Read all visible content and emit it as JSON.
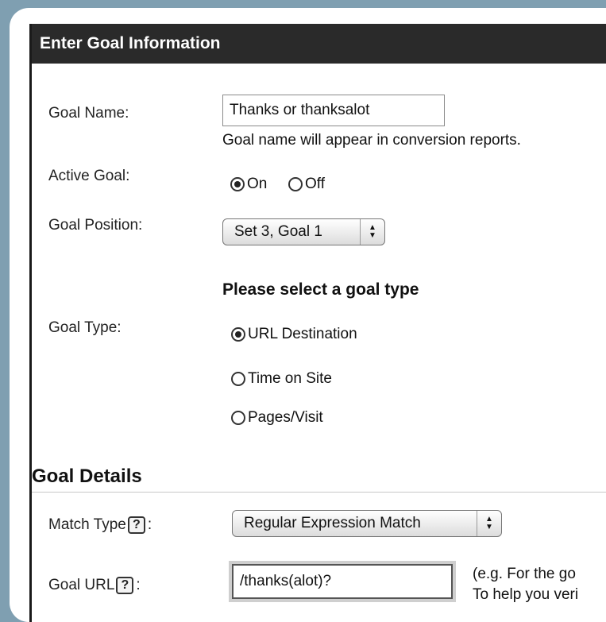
{
  "header": {
    "title": "Enter Goal Information"
  },
  "goal_name": {
    "label": "Goal Name:",
    "value": "Thanks or thanksalot",
    "hint": "Goal name will appear in conversion reports."
  },
  "active_goal": {
    "label": "Active Goal:",
    "options": [
      "On",
      "Off"
    ],
    "selected": "On"
  },
  "goal_position": {
    "label": "Goal Position:",
    "value": "Set 3, Goal 1"
  },
  "goal_type": {
    "heading": "Please select a goal type",
    "label": "Goal Type:",
    "options": [
      "URL Destination",
      "Time on Site",
      "Pages/Visit"
    ],
    "selected": "URL Destination"
  },
  "goal_details": {
    "title": "Goal Details",
    "match_type": {
      "label": "Match Type",
      "colon": ":",
      "help": "?",
      "value": "Regular Expression Match"
    },
    "goal_url": {
      "label": "Goal URL",
      "colon": ":",
      "help": "?",
      "value": "/thanks(alot)?",
      "hint_line1": "(e.g. For the go",
      "hint_line2": "To help you veri"
    }
  }
}
